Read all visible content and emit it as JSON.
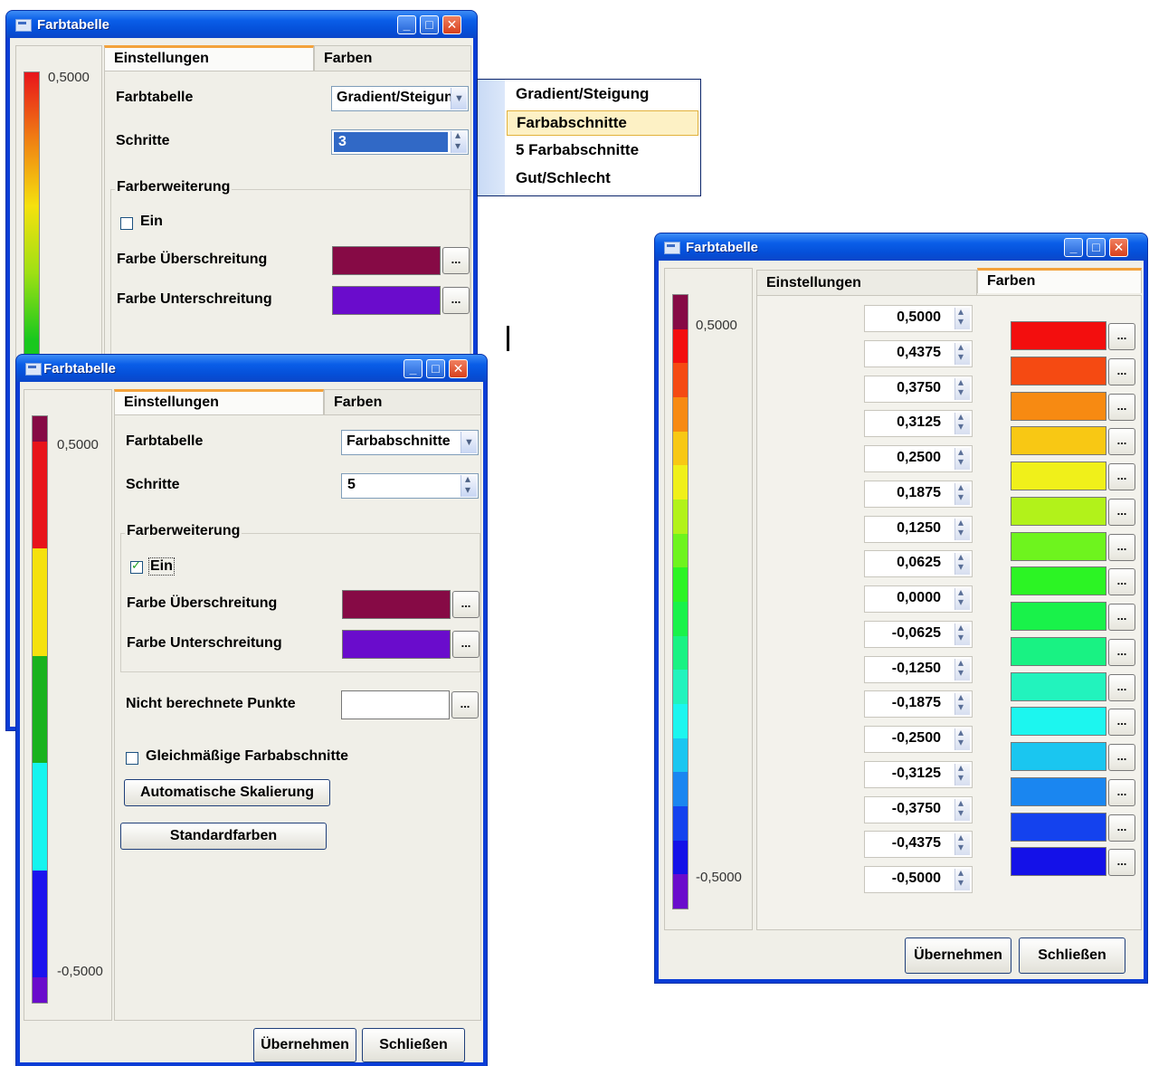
{
  "window_title": "Farbtabelle",
  "tabs": {
    "settings": "Einstellungen",
    "colors": "Farben"
  },
  "labels": {
    "color_table": "Farbtabelle",
    "steps": "Schritte",
    "color_extension": "Farberweiterung",
    "on": "Ein",
    "color_exceed": "Farbe Überschreitung",
    "color_below": "Farbe Unterschreitung",
    "not_computed": "Nicht berechnete Punkte",
    "uniform_sections": "Gleichmäßige Farbabschnitte",
    "auto_scale": "Automatische Skalierung",
    "standard_colors": "Standardfarben",
    "apply": "Übernehmen",
    "close": "Schließen",
    "ellipsis": "..."
  },
  "window1": {
    "scale_top": "0,5000",
    "color_table_value": "Gradient/Steigung",
    "steps_value": "3",
    "ext_on": false,
    "exceed_color": "#860a45",
    "below_color": "#6a0ccc"
  },
  "dropdown": {
    "items": [
      "Gradient/Steigung",
      "Farbabschnitte",
      "5 Farbabschnitte",
      "Gut/Schlecht"
    ],
    "highlighted": 1
  },
  "window2": {
    "scale_top": "0,5000",
    "scale_bottom": "-0,5000",
    "color_table_value": "Farbabschnitte",
    "steps_value": "5",
    "ext_on": true,
    "exceed_color": "#860a45",
    "below_color": "#6a0ccc",
    "not_computed_color": "#ffffff",
    "uniform_checked": false,
    "bar_colors": [
      "#860a45",
      "#e8141b",
      "#f5e10e",
      "#19b21e",
      "#16f4ef",
      "#1c13ee",
      "#6a0ccc"
    ]
  },
  "window3": {
    "scale_top": "0,5000",
    "scale_bottom": "-0,5000",
    "values": [
      "0,5000",
      "0,4375",
      "0,3750",
      "0,3125",
      "0,2500",
      "0,1875",
      "0,1250",
      "0,0625",
      "0,0000",
      "-0,0625",
      "-0,1250",
      "-0,1875",
      "-0,2500",
      "-0,3125",
      "-0,3750",
      "-0,4375",
      "-0,5000"
    ],
    "colors": [
      "#f30e0e",
      "#f54a12",
      "#f78a12",
      "#f8c814",
      "#f0f01a",
      "#b2f21a",
      "#6ef41e",
      "#2cf424",
      "#19f24a",
      "#19f283",
      "#22f3bd",
      "#1cf6ef",
      "#1ac6f0",
      "#1a86f0",
      "#1442ee",
      "#1411e8"
    ],
    "bar_colors": [
      "#860a45",
      "#f30e0e",
      "#f54a12",
      "#f78a12",
      "#f8c814",
      "#f0f01a",
      "#b2f21a",
      "#6ef41e",
      "#2cf424",
      "#19f24a",
      "#19f283",
      "#22f3bd",
      "#1cf6ef",
      "#1ac6f0",
      "#1a86f0",
      "#1442ee",
      "#1411e8",
      "#6a0ccc"
    ]
  }
}
